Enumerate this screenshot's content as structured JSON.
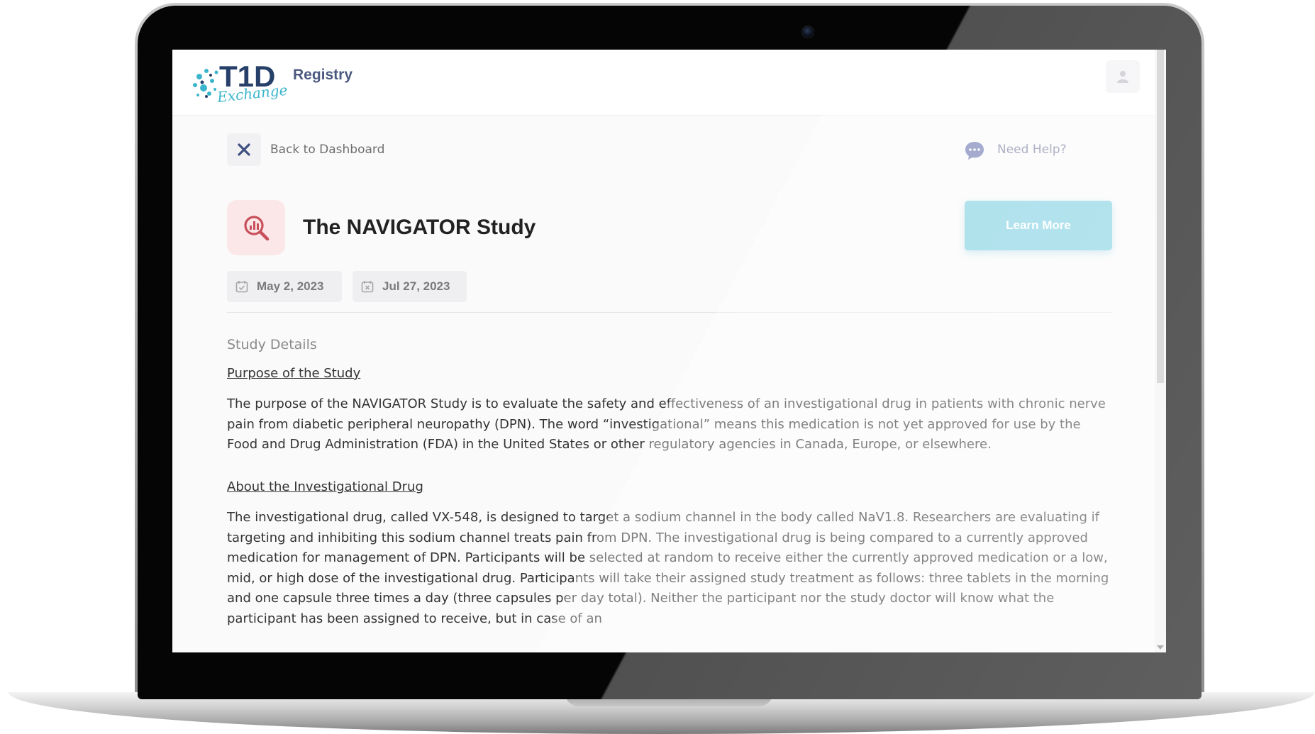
{
  "app": {
    "brand_name": "Registry",
    "logo_text": "T1D",
    "logo_script": "Exchange"
  },
  "nav": {
    "back_label": "Back to Dashboard",
    "help_label": "Need Help?"
  },
  "study": {
    "title": "The NAVIGATOR Study",
    "learn_more_label": "Learn More",
    "start_date": "May 2, 2023",
    "end_date": "Jul 27, 2023"
  },
  "details": {
    "section_title": "Study Details",
    "purpose_heading": "Purpose of the Study",
    "purpose_text": "The purpose of the NAVIGATOR Study is to evaluate the safety and effectiveness of an investigational drug in patients with chronic nerve pain from diabetic peripheral neuropathy (DPN). The word “investigational” means this medication is not yet approved for use by the Food and Drug Administration (FDA) in the United States or other regulatory agencies in Canada, Europe, or elsewhere.",
    "drug_heading": "About the Investigational Drug",
    "drug_text": "The investigational drug, called VX-548, is designed to target a sodium channel in the body called NaV1.8. Researchers are evaluating if targeting and inhibiting this sodium channel treats pain from DPN. The investigational drug is being compared to a currently approved medication for management of DPN. Participants will be selected at random to receive either the currently approved medication or a low, mid, or high dose of the investigational drug. Participants will take their assigned study treatment as follows: three tablets in the morning and one capsule three times a day (three capsules per day total). Neither the participant nor the study doctor will know what the participant has been assigned to receive, but in case of an"
  },
  "colors": {
    "brand_navy": "#4c5a80",
    "accent_cyan": "#7fd0e1",
    "study_icon_bg": "#fbe7e8",
    "study_icon_fg": "#c8505a"
  },
  "icons": {
    "close": "close-icon",
    "help": "chat-bubble-icon",
    "profile": "user-icon",
    "study": "magnifier-chart-icon",
    "start_date": "calendar-check-icon",
    "end_date": "calendar-x-icon"
  }
}
